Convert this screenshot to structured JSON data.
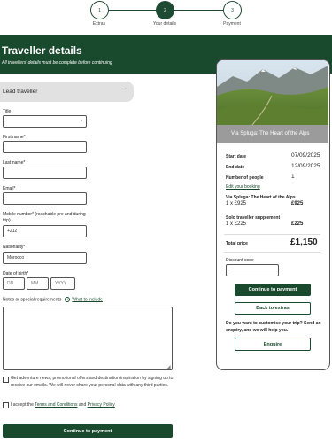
{
  "stepper": {
    "steps": [
      {
        "number": "1",
        "label": "Extras"
      },
      {
        "number": "2",
        "label": "Your details"
      },
      {
        "number": "3",
        "label": "Payment"
      }
    ]
  },
  "header": {
    "title": "Traveller details",
    "subtitle": "All travellers' details must be complete before continuing"
  },
  "lead": {
    "label": "Lead traveller",
    "chevron": "⌃"
  },
  "form": {
    "title_label": "Title",
    "title_value": "",
    "first_name_label": "First name*",
    "last_name_label": "Last name*",
    "email_label": "Email*",
    "mobile_label": "Mobile number* (reachable pre and during trip)",
    "mobile_value": "+212",
    "nationality_label": "Nationality*",
    "nationality_value": "Morocco",
    "dob_label": "Date of birth*",
    "dob_dd": "DD",
    "dob_mm": "MM",
    "dob_yyyy": "YYYY",
    "notes_label": "Notes or special requirements",
    "notes_info_icon": "i",
    "notes_link": "What to include",
    "newsletter_text": "Get adventure news, promotional offers and destination inspiration by signing up to receive our emails. We will never share your personal data with any third parties.",
    "terms_prefix": "I accept the ",
    "terms_link": "Terms and Conditions",
    "terms_and": " and ",
    "privacy_link": "Privacy Policy",
    "continue_label": "Continue to payment"
  },
  "summary": {
    "image_caption": "Via Spluga: The Heart of the Alps",
    "start_label": "Start date",
    "start_value": "07/09/2025",
    "end_label": "End date",
    "end_value": "12/09/2025",
    "people_label": "Number of people",
    "people_value": "1",
    "edit_link": "Edit your booking",
    "trip_name": "Via Spluga: The Heart of the Alps",
    "trip_qty": "1 x £925",
    "trip_price": "£925",
    "supp_name": "Solo traveller supplement",
    "supp_qty": "1 x £225",
    "supp_price": "£225",
    "total_label": "Total price",
    "total_value": "£1,150",
    "discount_label": "Discount code",
    "continue_label": "Continue to payment",
    "back_label": "Back to extras",
    "customise_text": "Do you want to customise your trip? Send an enquiry, and we will help you.",
    "enquire_label": "Enquire"
  },
  "colors": {
    "brand_green": "#1a4a2e",
    "caption_gray": "#9b9b9b",
    "lead_gray": "#e1e1e1"
  }
}
